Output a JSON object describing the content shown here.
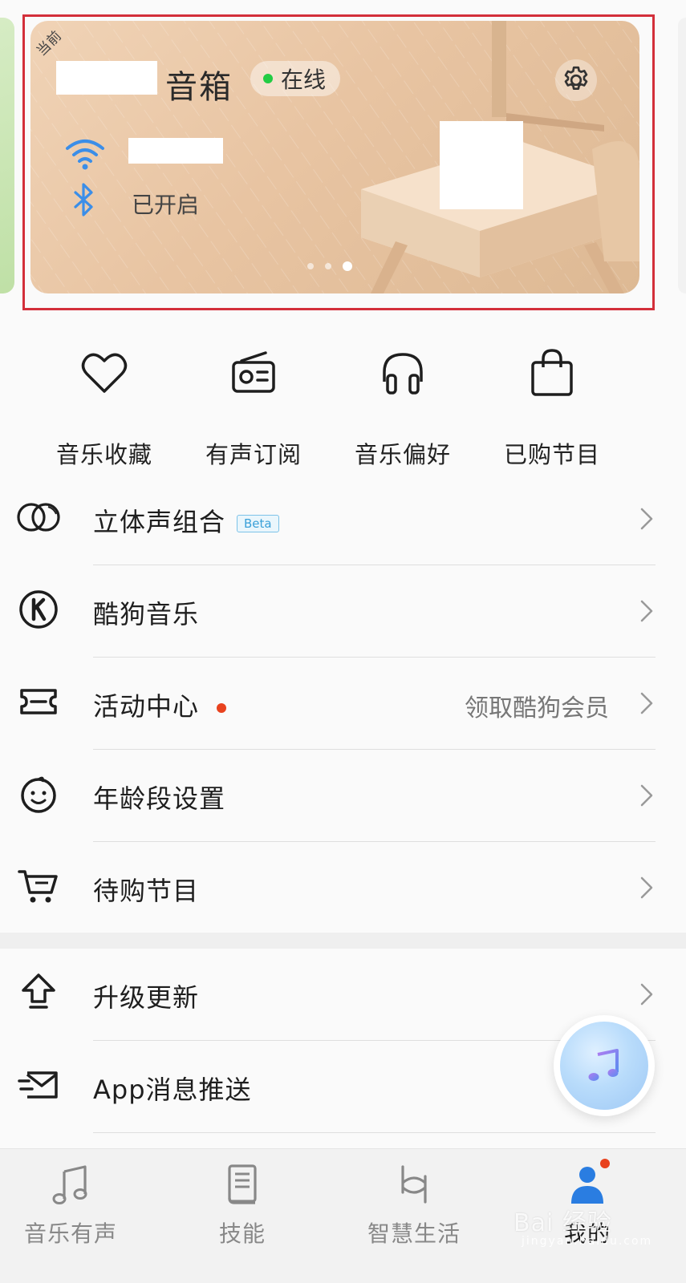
{
  "device_card": {
    "corner_tag": "当前",
    "device_name": "音箱",
    "status": "在线",
    "bluetooth_status": "已开启",
    "page_indicator": {
      "total": 3,
      "active": 3
    }
  },
  "shortcuts": [
    {
      "label": "音乐收藏",
      "icon": "heart-icon"
    },
    {
      "label": "有声订阅",
      "icon": "radio-icon"
    },
    {
      "label": "音乐偏好",
      "icon": "headphones-icon"
    },
    {
      "label": "已购节目",
      "icon": "shopping-bag-icon"
    }
  ],
  "menu": {
    "stereo": {
      "label": "立体声组合",
      "badge": "Beta"
    },
    "kugou": {
      "label": "酷狗音乐"
    },
    "activity": {
      "label": "活动中心",
      "value": "领取酷狗会员"
    },
    "age": {
      "label": "年龄段设置"
    },
    "pending": {
      "label": "待购节目"
    },
    "upgrade": {
      "label": "升级更新"
    },
    "push": {
      "label": "App消息推送"
    }
  },
  "bottom_nav": [
    {
      "label": "音乐有声",
      "icon": "music-note-icon",
      "active": false
    },
    {
      "label": "技能",
      "icon": "book-icon",
      "active": false
    },
    {
      "label": "智慧生活",
      "icon": "smart-life-icon",
      "active": false
    },
    {
      "label": "我的",
      "icon": "profile-icon",
      "active": true
    }
  ],
  "watermark": {
    "text": "Bai 经验",
    "sub": "jingyan.baidu.com"
  },
  "colors": {
    "highlight_border": "#d32f3a",
    "online_dot": "#22cc44",
    "notification_dot": "#e8421e",
    "beta_badge": "#3aa0d8",
    "bluetooth_icon": "#3b8ee8",
    "active_nav": "#2a7de1"
  }
}
